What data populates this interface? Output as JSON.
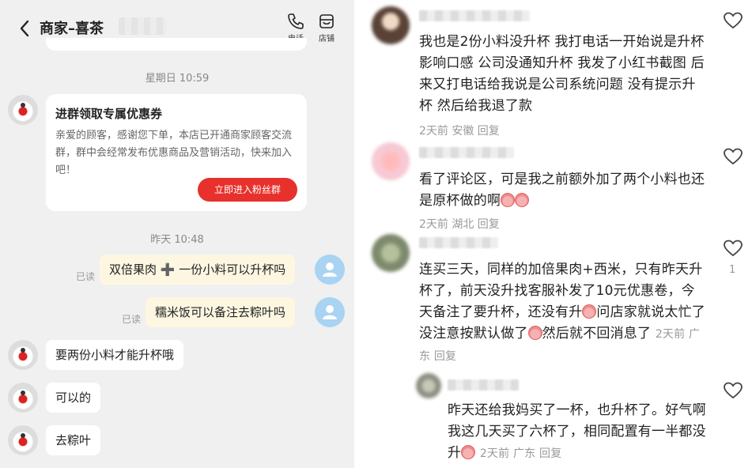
{
  "chat": {
    "title": "商家–喜茶",
    "actions": {
      "phone_label": "电话",
      "store_label": "店铺"
    },
    "time1": "星期日 10:59",
    "coupon": {
      "title": "进群领取专属优惠券",
      "body": "亲爱的顾客，感谢您下单，本店已开通商家顾客交流群，群中会经常发布优惠商品及营销活动，快来加入吧！",
      "button": "立即进入粉丝群"
    },
    "time2": "昨天 10:48",
    "msg1": "双倍果肉 ➕ 一份小料可以升杯吗",
    "msg2": "糯米饭可以备注去粽叶吗",
    "read_label": "已读",
    "reply1": "要两份小料才能升杯哦",
    "reply2": "可以的",
    "reply3": "去粽叶"
  },
  "comments": [
    {
      "text": "我也是2份小料没升杯 我打电话一开始说是升杯影响口感 公司没通知升杯 我发了小红书截图 后来又打电话给我说是公司系统问题 没有提示升杯 然后给我退了款",
      "meta": "2天前 安徽  回复"
    },
    {
      "text": "看了评论区，可是我之前额外加了两个小料也还是原杯做的啊",
      "meta": "2天前 湖北  回复"
    },
    {
      "text": "连买三天，同样的加倍果肉+西米，只有昨天升杯了，前天没升找客服补发了10元优惠卷，今天备注了要升杯，还没有升",
      "text2": "问店家就说太忙了没注意按默认做了",
      "text3": "然后就不回消息了",
      "meta": "2天前 广东  回复",
      "likes": "1"
    },
    {
      "text": "昨天还给我妈买了一杯，也升杯了。好气啊我这几天买了六杯了，相同配置有一半都没升",
      "meta": "2天前 广东  回复"
    }
  ]
}
